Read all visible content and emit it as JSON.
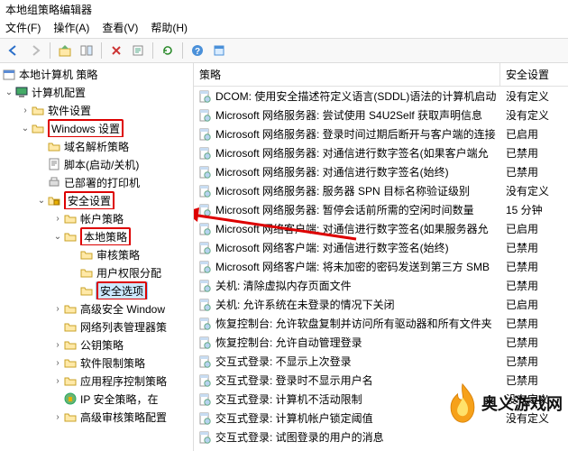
{
  "window": {
    "title": "本地组策略编辑器"
  },
  "menu": {
    "file": "文件(F)",
    "action": "操作(A)",
    "view": "查看(V)",
    "help": "帮助(H)"
  },
  "toolbar_icons": {
    "back": "back-arrow-icon",
    "forward": "forward-arrow-icon",
    "up": "up-folder-icon",
    "show": "show-hide-icon",
    "delete": "delete-icon",
    "export": "export-icon",
    "refresh": "refresh-icon",
    "help": "help-icon",
    "properties": "properties-icon"
  },
  "tree": {
    "root": "本地计算机 策略",
    "computer_config": "计算机配置",
    "software_settings": "软件设置",
    "windows_settings": "Windows 设置",
    "name_resolution": "域名解析策略",
    "scripts": "脚本(启动/关机)",
    "deployed_printers": "已部署的打印机",
    "security_settings": "安全设置",
    "account_policies": "帐户策略",
    "local_policies": "本地策略",
    "audit_policy": "审核策略",
    "user_rights": "用户权限分配",
    "security_options": "安全选项",
    "adv_windows": "高级安全 Window",
    "network_list": "网络列表管理器策",
    "public_key": "公钥策略",
    "software_restrict": "软件限制策略",
    "app_control": "应用程序控制策略",
    "ip_security": "IP 安全策略，在 ",
    "adv_audit": "高级审核策略配置"
  },
  "columns": {
    "policy": "策略",
    "setting": "安全设置"
  },
  "rows": [
    {
      "name": "DCOM: 使用安全描述符定义语言(SDDL)语法的计算机启动",
      "value": "没有定义"
    },
    {
      "name": "Microsoft 网络服务器: 尝试使用 S4U2Self 获取声明信息",
      "value": "没有定义"
    },
    {
      "name": "Microsoft 网络服务器: 登录时间过期后断开与客户端的连接",
      "value": "已启用"
    },
    {
      "name": "Microsoft 网络服务器: 对通信进行数字签名(如果客户端允",
      "value": "已禁用"
    },
    {
      "name": "Microsoft 网络服务器: 对通信进行数字签名(始终)",
      "value": "已禁用"
    },
    {
      "name": "Microsoft 网络服务器: 服务器 SPN 目标名称验证级别",
      "value": "没有定义"
    },
    {
      "name": "Microsoft 网络服务器: 暂停会话前所需的空闲时间数量",
      "value": "15 分钟"
    },
    {
      "name": "Microsoft 网络客户端: 对通信进行数字签名(如果服务器允",
      "value": "已启用"
    },
    {
      "name": "Microsoft 网络客户端: 对通信进行数字签名(始终)",
      "value": "已禁用"
    },
    {
      "name": "Microsoft 网络客户端: 将未加密的密码发送到第三方 SMB",
      "value": "已禁用"
    },
    {
      "name": "关机: 清除虚拟内存页面文件",
      "value": "已禁用"
    },
    {
      "name": "关机: 允许系统在未登录的情况下关闭",
      "value": "已启用"
    },
    {
      "name": "恢复控制台: 允许软盘复制并访问所有驱动器和所有文件夹",
      "value": "已禁用"
    },
    {
      "name": "恢复控制台: 允许自动管理登录",
      "value": "已禁用"
    },
    {
      "name": "交互式登录: 不显示上次登录",
      "value": "已禁用"
    },
    {
      "name": "交互式登录: 登录时不显示用户名",
      "value": "已禁用"
    },
    {
      "name": "交互式登录: 计算机不活动限制",
      "value": "没有定义"
    },
    {
      "name": "交互式登录: 计算机帐户锁定阈值",
      "value": "没有定义"
    },
    {
      "name": "交互式登录: 试图登录的用户的消息",
      "value": ""
    }
  ],
  "watermark": "奥义游戏网"
}
